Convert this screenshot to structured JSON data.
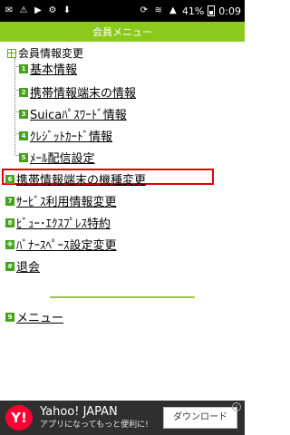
{
  "status_bar": {
    "battery": "41%",
    "time": "0:09"
  },
  "header": {
    "title": "会員メニュー"
  },
  "section": {
    "label": "会員情報変更"
  },
  "items": [
    {
      "num": "1",
      "label": "基本情報"
    },
    {
      "num": "2",
      "label": "携帯情報端末の情報"
    },
    {
      "num": "3",
      "label": "Suicaﾊﾟｽﾜｰﾄﾞ情報"
    },
    {
      "num": "4",
      "label": "ｸﾚｼﾞｯﾄｶｰﾄﾞ情報"
    },
    {
      "num": "5",
      "label": "ﾒｰﾙ配信設定"
    },
    {
      "num": "6",
      "label": "携帯情報端末の機種変更"
    },
    {
      "num": "7",
      "label": "ｻｰﾋﾞｽ利用情報変更"
    },
    {
      "num": "8",
      "label": "ﾋﾞｭｰ･ｴｸｽﾌﾟﾚｽ特約"
    },
    {
      "num": "※",
      "label": "ﾊﾞﾅｰｽﾍﾟｰｽ設定変更"
    },
    {
      "num": "#",
      "label": "退会"
    },
    {
      "num": "9",
      "label": "メニュー"
    }
  ],
  "ad": {
    "logo": "Y!",
    "title": "Yahoo! JAPAN",
    "subtitle": "アプリになってもっと便利に!",
    "button": "ダウンロード",
    "info": "i"
  }
}
